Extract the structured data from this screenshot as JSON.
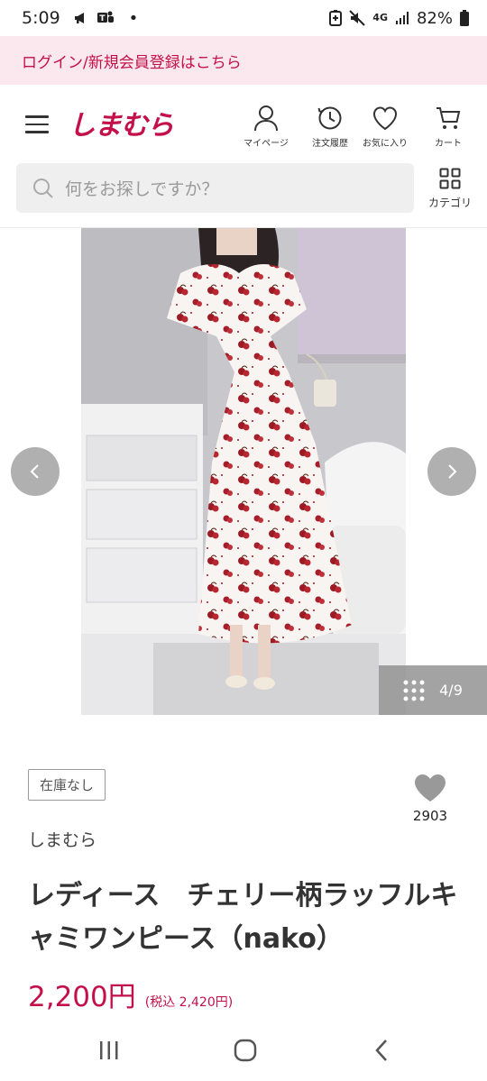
{
  "status_bar": {
    "time": "5:09",
    "dot": "•",
    "network": "4G",
    "battery": "82%",
    "left_icons": [
      "megaphone-icon",
      "teams-icon"
    ],
    "right_icons": [
      "battery-saver-icon",
      "mute-icon",
      "signal-icon",
      "battery-icon"
    ]
  },
  "login_banner": {
    "text": "ログイン/新規会員登録はこちら"
  },
  "header": {
    "logo": "しまむら",
    "buttons": [
      {
        "label": "マイページ",
        "icon": "person-icon"
      },
      {
        "label": "注文履歴",
        "icon": "clock-icon"
      },
      {
        "label": "お気に入り",
        "icon": "heart-icon"
      },
      {
        "label": "カート",
        "icon": "cart-icon"
      }
    ]
  },
  "search": {
    "placeholder": "何をお探しですか？",
    "category_label": "カテゴリ"
  },
  "gallery": {
    "counter": "4/9",
    "prev_icon": "chevron-left-icon",
    "next_icon": "chevron-right-icon",
    "grid_icon": "grid-icon"
  },
  "product": {
    "stock_status": "在庫なし",
    "favorite_count": "2903",
    "brand": "しまむら",
    "title": "レディース　チェリー柄ラッフルキャミワンピース（nako）",
    "price": "2,200円",
    "price_tax": "(税込 2,420円)"
  },
  "colors": {
    "accent": "#c4104a",
    "banner_bg": "#fbe8ee"
  }
}
